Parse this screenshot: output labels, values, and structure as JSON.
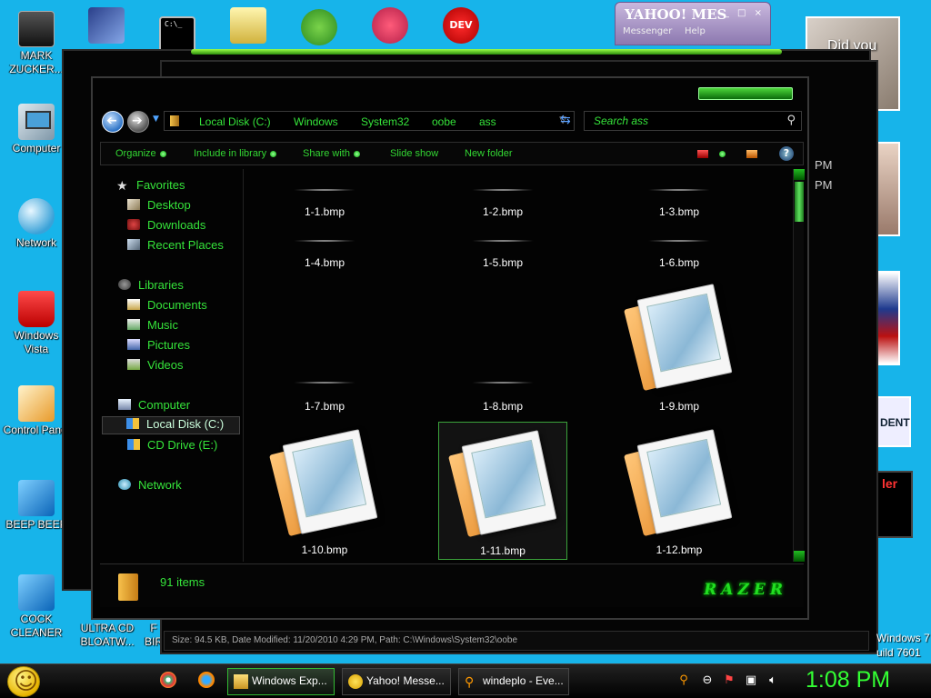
{
  "desktop": {
    "icons_left": [
      {
        "label": "MARK ZUCKER...",
        "icon": "user-portrait-icon"
      },
      {
        "label": "Computer",
        "icon": "computer-icon"
      },
      {
        "label": "Network",
        "icon": "network-icon"
      },
      {
        "label": "Windows Vista",
        "icon": "recycle-bin-icon"
      },
      {
        "label": "Control Panel",
        "icon": "control-panel-icon"
      },
      {
        "label": "BEEP BEEP",
        "icon": "shortcut-icon"
      },
      {
        "label": "COCK CLEANER",
        "icon": "shortcut-icon"
      }
    ],
    "bottom_labels": [
      "ULTRA CD BLOATW...",
      "F BIR"
    ],
    "top_icons": [
      "blue-document-icon",
      "command-prompt-icon",
      "folder-icon",
      "angry-birds-icon",
      "picasa-icon",
      "dev-cpp-icon"
    ],
    "dev_icon_text": "DEV"
  },
  "yahoo": {
    "title": "YAHOO! MES",
    "menu": [
      "Messenger",
      "Help"
    ]
  },
  "side_text": {
    "did_you": "Did you",
    "times": [
      "PM",
      "PM"
    ],
    "dent": "DENT",
    "ler": "ler",
    "windows7": "Windows 7",
    "build": "uild 7601"
  },
  "explorer": {
    "breadcrumb": [
      "Local Disk (C:)",
      "Windows",
      "System32",
      "oobe",
      "ass"
    ],
    "search_placeholder": "Search ass",
    "commands": [
      "Organize",
      "Include in library",
      "Share with",
      "Slide show",
      "New folder"
    ],
    "help": "?",
    "nav": {
      "favorites": "Favorites",
      "favorite_items": [
        "Desktop",
        "Downloads",
        "Recent Places"
      ],
      "libraries": "Libraries",
      "library_items": [
        "Documents",
        "Music",
        "Pictures",
        "Videos"
      ],
      "computer": "Computer",
      "computer_items": [
        "Local Disk (C:)",
        "CD Drive (E:)"
      ],
      "network": "Network"
    },
    "files": [
      "1-1.bmp",
      "1-2.bmp",
      "1-3.bmp",
      "1-4.bmp",
      "1-5.bmp",
      "1-6.bmp",
      "1-7.bmp",
      "1-8.bmp",
      "1-9.bmp",
      "1-10.bmp",
      "1-11.bmp",
      "1-12.bmp"
    ],
    "selected_file": "1-11.bmp",
    "item_count": "91 items",
    "brand": "RAZER"
  },
  "status_strip": "Size: 94.5 KB, Date Modified: 11/20/2010 4:29 PM, Path: C:\\Windows\\System32\\oobe",
  "taskbar": {
    "buttons": [
      "Windows Exp...",
      "Yahoo! Messe...",
      "windeplo - Eve..."
    ],
    "clock": "1:08 PM"
  },
  "colors": {
    "desktop_bg": "#17b4ea",
    "accent_green": "#35e33a",
    "window_bg": "#030303"
  }
}
